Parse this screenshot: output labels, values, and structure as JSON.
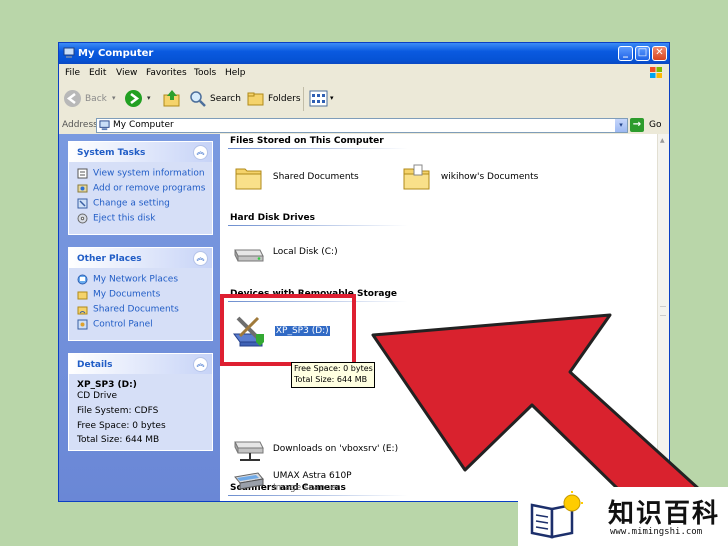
{
  "window": {
    "title": "My Computer",
    "controls": {
      "minimize": "_",
      "maximize": "□",
      "close": "✕"
    }
  },
  "menu": [
    "File",
    "Edit",
    "View",
    "Favorites",
    "Tools",
    "Help"
  ],
  "toolbar": {
    "back": "Back",
    "search": "Search",
    "folders": "Folders"
  },
  "address": {
    "label": "Address",
    "value": "My Computer",
    "go": "Go"
  },
  "sidebar": {
    "system_tasks": {
      "title": "System Tasks",
      "items": [
        "View system information",
        "Add or remove programs",
        "Change a setting",
        "Eject this disk"
      ]
    },
    "other_places": {
      "title": "Other Places",
      "items": [
        "My Network Places",
        "My Documents",
        "Shared Documents",
        "Control Panel"
      ]
    },
    "details": {
      "title": "Details",
      "name": "XP_SP3 (D:)",
      "type": "CD Drive",
      "filesystem": "File System: CDFS",
      "free": "Free Space: 0 bytes",
      "total": "Total Size: 644 MB"
    }
  },
  "content": {
    "group_files": "Files Stored on This Computer",
    "shared_docs": "Shared Documents",
    "user_docs": "wikihow's Documents",
    "group_hdd": "Hard Disk Drives",
    "local_disk": "Local Disk (C:)",
    "group_removable": "Devices with Removable Storage",
    "cd_drive": "XP_SP3 (D:)",
    "network_drive": "Downloads on 'vboxsrv' (E:)",
    "group_scanners": "Scanners and Cameras",
    "scanner_name": "UMAX Astra 610P",
    "scanner_type": "Image scanner"
  },
  "tooltip": {
    "free": "Free Space: 0 bytes",
    "total": "Total Size: 644 MB"
  },
  "watermark": {
    "text": "知识百科",
    "url": "www.mimingshi.com"
  },
  "colors": {
    "title_bar": "#0a5ae0",
    "highlight_box": "#de1f31",
    "arrow": "#d9222e",
    "sidebar": "#6a87d6"
  }
}
